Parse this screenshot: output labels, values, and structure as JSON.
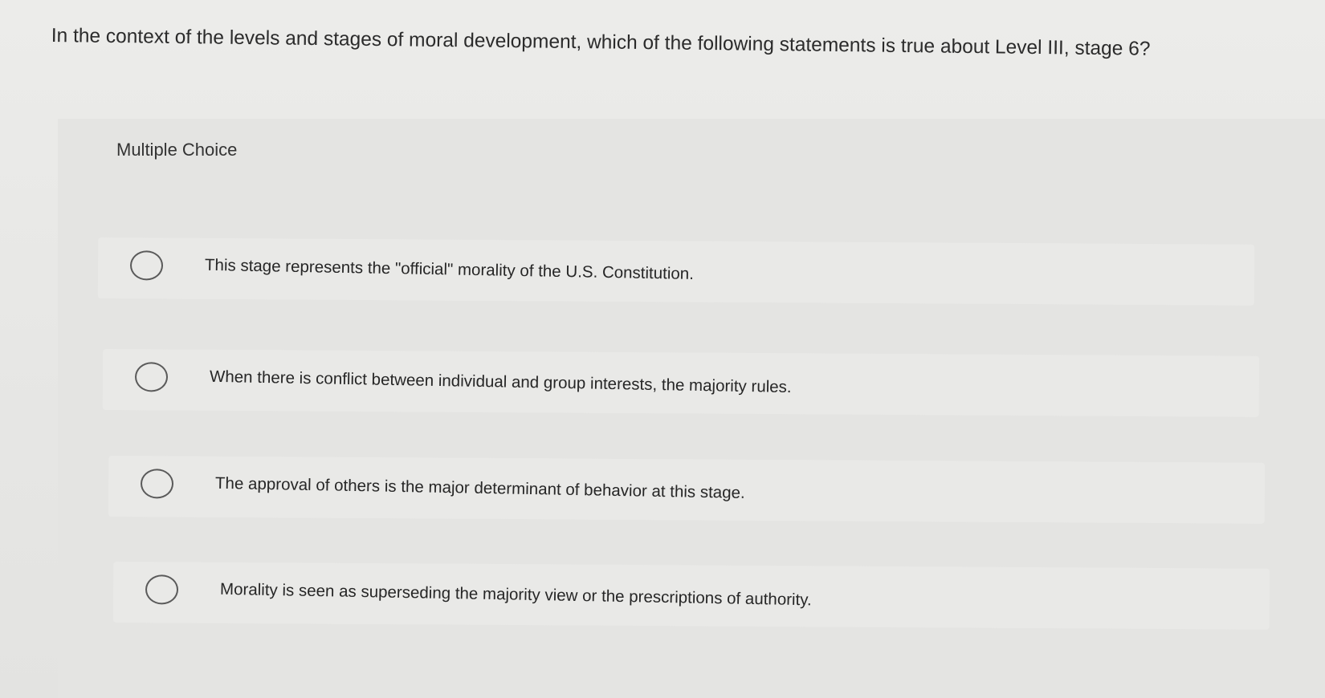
{
  "question": {
    "text": "In the context of the levels and stages of moral development, which of the following statements is true about Level III, stage 6?"
  },
  "panel": {
    "label": "Multiple Choice"
  },
  "options": [
    {
      "text": "This stage represents the \"official\" morality of the U.S. Constitution."
    },
    {
      "text": "When there is conflict between individual and group interests, the majority rules."
    },
    {
      "text": "The approval of others is the major determinant of behavior at this stage."
    },
    {
      "text": "Morality is seen as superseding the majority view or the prescriptions of authority."
    }
  ]
}
